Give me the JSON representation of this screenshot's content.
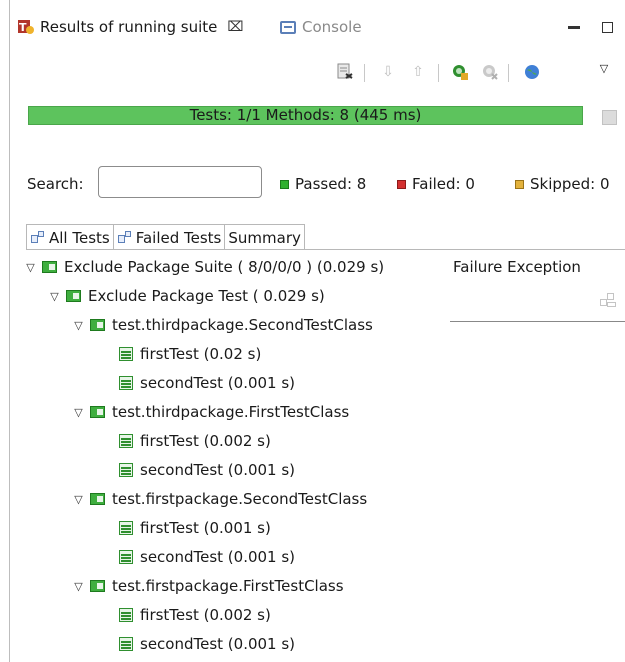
{
  "tabs": {
    "active_label": "Results of running suite",
    "inactive_label": "Console"
  },
  "toolbar": {
    "icons": [
      "rerun-icon",
      "next-failure-icon",
      "previous-failure-icon",
      "rerun-failed-icon",
      "rerun-failed-disabled-icon",
      "globe-icon",
      "view-menu-icon"
    ]
  },
  "progress": {
    "text": "Tests: 1/1  Methods: 8 (445 ms)",
    "fraction": 1.0,
    "color": "#5dc35d"
  },
  "search": {
    "label": "Search:",
    "value": "",
    "placeholder": ""
  },
  "counters": {
    "passed_label": "Passed: 8",
    "failed_label": "Failed: 0",
    "skipped_label": "Skipped: 0"
  },
  "subtabs": {
    "all": "All Tests",
    "failed": "Failed Tests",
    "summary": "Summary"
  },
  "tree": {
    "suite": "Exclude Package Suite ( 8/0/0/0 ) (0.029 s)",
    "test": "Exclude Package Test ( 0.029 s)",
    "classes": [
      {
        "name": "test.thirdpackage.SecondTestClass",
        "methods": [
          "firstTest  (0.02 s)",
          "secondTest  (0.001 s)"
        ]
      },
      {
        "name": "test.thirdpackage.FirstTestClass",
        "methods": [
          "firstTest  (0.002 s)",
          "secondTest  (0.001 s)"
        ]
      },
      {
        "name": "test.firstpackage.SecondTestClass",
        "methods": [
          "firstTest  (0.001 s)",
          "secondTest  (0.001 s)"
        ]
      },
      {
        "name": "test.firstpackage.FirstTestClass",
        "methods": [
          "firstTest  (0.002 s)",
          "secondTest  (0.001 s)"
        ]
      }
    ]
  },
  "failure": {
    "title": "Failure Exception"
  }
}
